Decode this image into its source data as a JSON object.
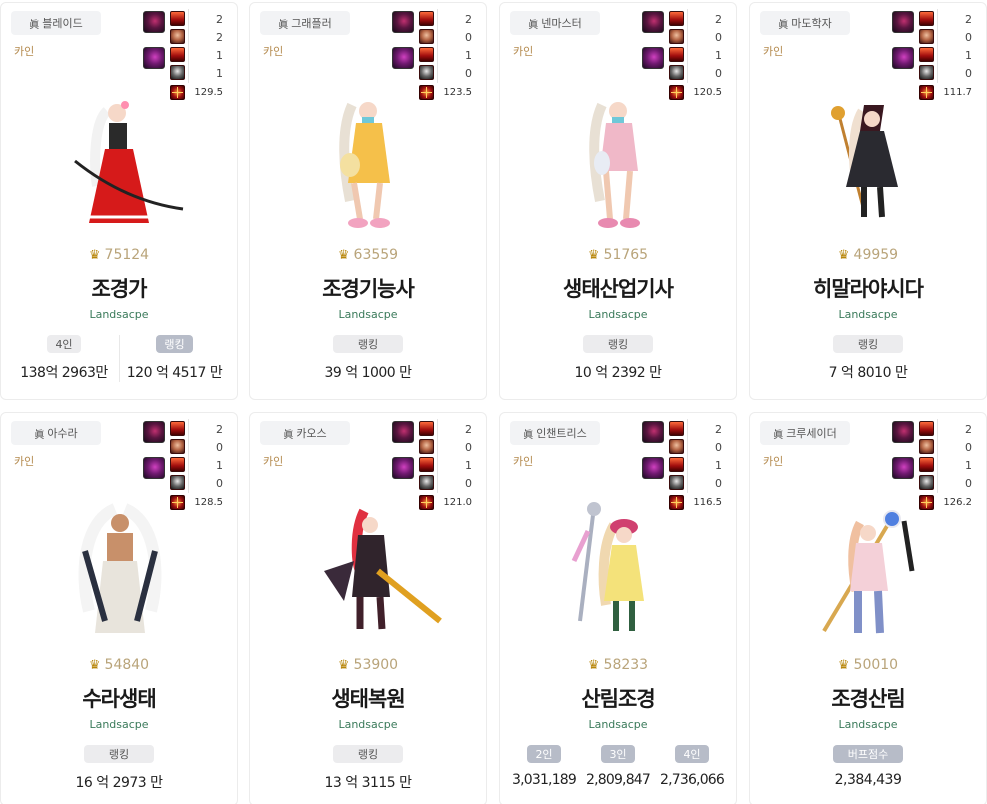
{
  "cards": [
    {
      "job": "블레이드",
      "server": "카인",
      "equip_counts": [
        "2",
        "2",
        "1",
        "1"
      ],
      "equip_score": "129.5",
      "fame": "75124",
      "name": "조경가",
      "guild": "Landsacpe",
      "stats": [
        {
          "label": "4인",
          "value": "138억 2963만"
        },
        {
          "label": "랭킹",
          "value": "120 억 4517 만"
        }
      ],
      "colors": {
        "body": "#d61a1a",
        "hair": "#f2f2f2",
        "accent": "#ff8fb0"
      }
    },
    {
      "job": "그래플러",
      "server": "카인",
      "equip_counts": [
        "2",
        "0",
        "1",
        "0"
      ],
      "equip_score": "123.5",
      "fame": "63559",
      "name": "조경기능사",
      "guild": "Landsacpe",
      "stats": [
        {
          "label": "랭킹",
          "value": "39 억 1000 만"
        }
      ],
      "colors": {
        "body": "#f5c04a",
        "hair": "#e8e0d4",
        "accent": "#f2a3c0"
      }
    },
    {
      "job": "넨마스터",
      "server": "카인",
      "equip_counts": [
        "2",
        "0",
        "1",
        "0"
      ],
      "equip_score": "120.5",
      "fame": "51765",
      "name": "생태산업기사",
      "guild": "Landsacpe",
      "stats": [
        {
          "label": "랭킹",
          "value": "10 억 2392 만"
        }
      ],
      "colors": {
        "body": "#f0b8c8",
        "hair": "#e8e0d4",
        "accent": "#e88ab0"
      }
    },
    {
      "job": "마도학자",
      "server": "카인",
      "equip_counts": [
        "2",
        "0",
        "1",
        "0"
      ],
      "equip_score": "111.7",
      "fame": "49959",
      "name": "히말라야시다",
      "guild": "Landsacpe",
      "stats": [
        {
          "label": "랭킹",
          "value": "7 억 8010 만"
        }
      ],
      "colors": {
        "body": "#2a2a30",
        "hair": "#f0e0d0",
        "accent": "#e0a030"
      }
    },
    {
      "job": "아수라",
      "server": "카인",
      "equip_counts": [
        "2",
        "0",
        "1",
        "0"
      ],
      "equip_score": "128.5",
      "fame": "54840",
      "name": "수라생태",
      "guild": "Landsacpe",
      "stats": [
        {
          "label": "랭킹",
          "value": "16 억 2973 만"
        }
      ],
      "colors": {
        "body": "#e8e4dc",
        "hair": "#f4f4f4",
        "accent": "#2a3040"
      }
    },
    {
      "job": "카오스",
      "server": "카인",
      "equip_counts": [
        "2",
        "0",
        "1",
        "0"
      ],
      "equip_score": "121.0",
      "fame": "53900",
      "name": "생태복원",
      "guild": "Landsacpe",
      "stats": [
        {
          "label": "랭킹",
          "value": "13 억 3115 만"
        }
      ],
      "colors": {
        "body": "#30242c",
        "hair": "#e03040",
        "accent": "#e0a020"
      }
    },
    {
      "job": "인챈트리스",
      "server": "카인",
      "equip_counts": [
        "2",
        "0",
        "1",
        "0"
      ],
      "equip_score": "116.5",
      "fame": "58233",
      "name": "산림조경",
      "guild": "Landsacpe",
      "stats": [
        {
          "label": "2인",
          "value": "3,031,189"
        },
        {
          "label": "3인",
          "value": "2,809,847"
        },
        {
          "label": "4인",
          "value": "2,736,066"
        }
      ],
      "colors": {
        "body": "#f4e27a",
        "hair": "#f0d8b0",
        "accent": "#e8a0d0"
      }
    },
    {
      "job": "크루세이더",
      "server": "카인",
      "equip_counts": [
        "2",
        "0",
        "1",
        "0"
      ],
      "equip_score": "126.2",
      "fame": "50010",
      "name": "조경산림",
      "guild": "Landsacpe",
      "stats": [
        {
          "label": "버프점수",
          "value": "2,384,439"
        }
      ],
      "colors": {
        "body": "#f4d0d8",
        "hair": "#f0c0a0",
        "accent": "#8090c8"
      }
    }
  ]
}
